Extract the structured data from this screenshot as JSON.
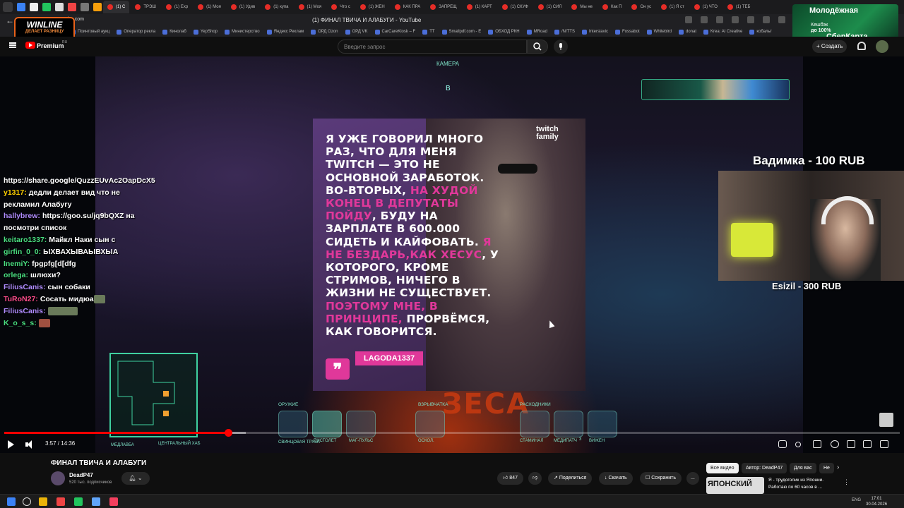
{
  "browser": {
    "tabs": [
      "(1) С",
      "ТРЭШ",
      "(1) Exp",
      "(1) Моя",
      "(1) Удив",
      "(1) купа",
      "(1) Моя",
      "Что с",
      "(1) ЖЕН",
      "КАК ПРА",
      "ЗАПРЕЩ",
      "(1) КАРТ",
      "(1) СКУФ",
      "(1) СИЛ",
      "Мы не",
      "Как П",
      "Он ус",
      "(1) Я ст",
      "(1) ЧТО",
      "(1) ТЕБ"
    ],
    "url": "be.com",
    "page_title": "(1) ФИНАЛ ТВИЧА И АЛАБУГИ - YouTube",
    "bookmarks": [
      "Поинтовый аукц",
      "Оператор рекла",
      "Кинолаб",
      "YepShop",
      "Министерство",
      "Яндекс Реклам",
      "ОРД Ozon",
      "ОРД VK",
      "CarCareKiosk – F",
      "TT",
      "Smallpdf.com - E",
      "ОБХОД РКН",
      "MRoad",
      "/N/TTS",
      "Interslavic",
      "Fossabot",
      "Whitebird",
      "donat",
      "Krea: AI Creative",
      "кобальт"
    ]
  },
  "ads": {
    "winline_logo": "WINLINE",
    "winline_tagline": "ДЕЛАЕТ РАЗНИЦУ",
    "sber_headline": "Молодёжная",
    "sber_line1": "Кешбэк",
    "sber_line2": "до 100%",
    "sber_brand": "СберКарта"
  },
  "youtube": {
    "premium_label": "Premium",
    "premium_region": "RU",
    "search_placeholder": "Введите запрос",
    "create_label": "+ Создать"
  },
  "video": {
    "hud_camera": "КАМЕРА",
    "hud_marker": "B",
    "quote_logo": "twitch family",
    "quote_lines": [
      {
        "text": "Я уже говорил много раз, что для меня Twitch — это не основной заработок. Во-вторых, ",
        "pink": false
      },
      {
        "text": "на худой конец в депутаты пойду",
        "pink": true
      },
      {
        "text": ", буду на зарплате в 600.000 сидеть и кайфовать. ",
        "pink": false
      },
      {
        "text": "Я не бездарь,как Хесус",
        "pink": true
      },
      {
        "text": ", у которого, кроме стримов, ничего в жизни не существует. ",
        "pink": false
      },
      {
        "text": "Поэтому мне, в принципе, ",
        "pink": true
      },
      {
        "text": "прорвёмся, как говорится.",
        "pink": false
      }
    ],
    "quote_author": "LAGODA1337",
    "chat": [
      {
        "user": "",
        "color": "#ffffff",
        "text": "https://share.google/QuzzEUvAc2OapDcX5"
      },
      {
        "user": "y1317:",
        "color": "#ffd000",
        "text": "дедли делает вид что не рекламил Алабугу"
      },
      {
        "user": "hallybrew:",
        "color": "#b08cff",
        "text": "https://goo.su/jq9bQXZ на посмотри список"
      },
      {
        "user": "keitaro1337:",
        "color": "#4ade80",
        "text": "Майкл Наки сын с"
      },
      {
        "user": "girfin_0_0:",
        "color": "#4ade80",
        "text": "ЫХВАХЫВАЫВХЫА"
      },
      {
        "user": "InemiY:",
        "color": "#4ade80",
        "text": "fpgpfg[d[dfg"
      },
      {
        "user": "orlega:",
        "color": "#4ade80",
        "text": "шлюхи?"
      },
      {
        "user": "FiliusCanis:",
        "color": "#b08cff",
        "text": "сын собаки"
      },
      {
        "user": "TuRoN27:",
        "color": "#ff4d8c",
        "text": "Сосать мидюа"
      },
      {
        "user": "FiliusCanis:",
        "color": "#b08cff",
        "text": ""
      },
      {
        "user": "K_o_s_s:",
        "color": "#4ade80",
        "text": ""
      }
    ],
    "donation_top": "Вадимка - 100 RUB",
    "donation_bottom": "Esizil - 300 RUB",
    "zeca": "ЗЕСА",
    "minimap_left": "МЕДЛАВБА",
    "minimap_right": "ЦЕНТРАЛЬНЫЙ ХАБ",
    "weapon_groups": [
      "ОРУЖИЕ",
      "ВЗРЫВЧАТКА",
      "РАСХОДНИКИ"
    ],
    "weapon_labels": [
      "СВИНЦОВАЯ ТРУБА",
      "ПИСТОЛЕТ",
      "МАГ-ПУЛЬС",
      "ОСКОЛ.",
      "СТАМИНАЛ",
      "МЕДИПАТЧ",
      "ВИЖЕН"
    ],
    "weapon_count_medipatch": "3",
    "progress": 0.25,
    "buffered": 0.27,
    "time": "3:57 / 14:36"
  },
  "info": {
    "title": "ФИНАЛ ТВИЧА И АЛАБУГИ",
    "channel": "DeadP47",
    "subscribers": "520 тыс. подписчиков",
    "likes": "847",
    "share": "Поделиться",
    "download": "Скачать",
    "save": "Сохранить",
    "more": "...",
    "chips": [
      "Все видео",
      "Автор: DeadP47",
      "Для вас",
      "Не"
    ],
    "rec_thumb_text": "ЯПОНСКИЙ",
    "rec_title": "Я - трудоголик из Японии. Работаю по 60 часов в ..."
  },
  "taskbar": {
    "tray_lang": "ENG",
    "time": "17:01",
    "date": "30.04.2026"
  },
  "colors": {
    "accent_red": "#ff0000",
    "quote_pink": "#e0389a",
    "hud_cyan": "#7fe3c8"
  }
}
